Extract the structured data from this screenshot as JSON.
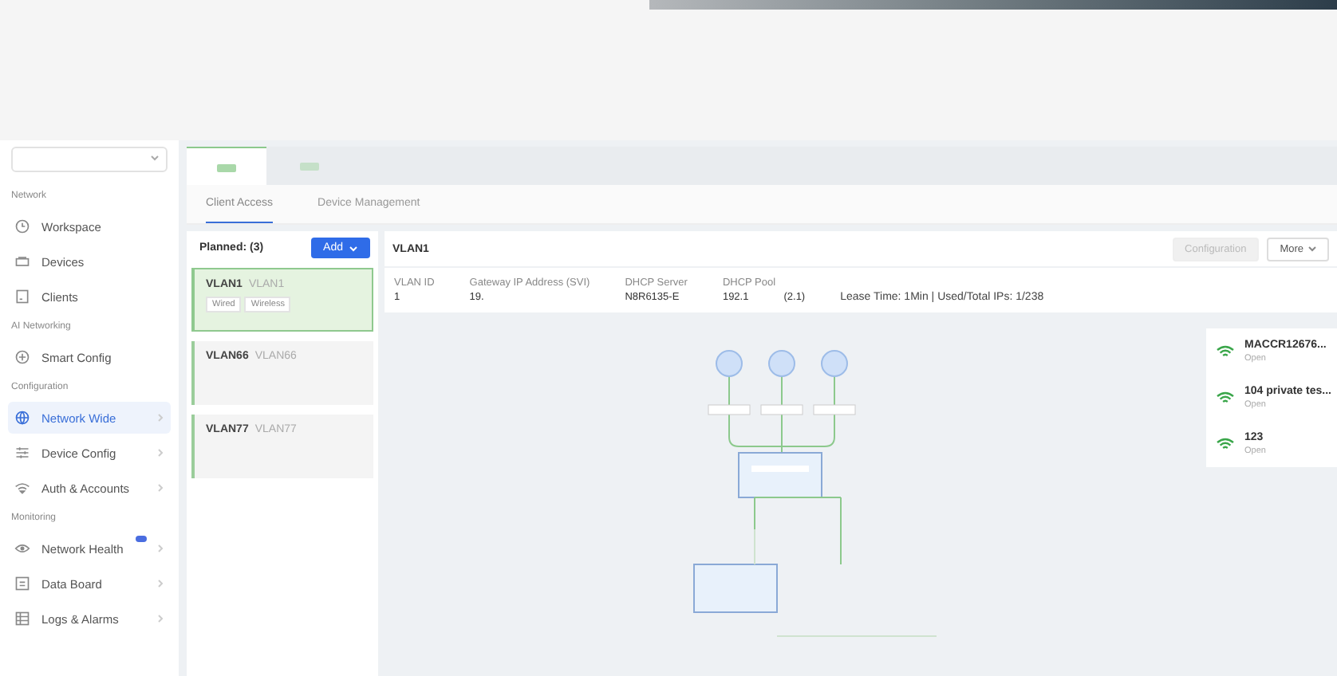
{
  "sidebar": {
    "sections": [
      {
        "label": "Network",
        "items": [
          {
            "label": "Workspace",
            "kind": "link",
            "selected": false
          },
          {
            "label": "Devices",
            "kind": "link",
            "selected": false
          },
          {
            "label": "Clients",
            "kind": "link",
            "selected": false
          }
        ]
      },
      {
        "label": "AI Networking",
        "items": [
          {
            "label": "Smart Config",
            "kind": "link",
            "selected": false
          }
        ]
      },
      {
        "label": "Configuration",
        "items": [
          {
            "label": "Network Wide",
            "kind": "group",
            "selected": true
          },
          {
            "label": "Device Config",
            "kind": "group",
            "selected": false
          },
          {
            "label": "Auth & Accounts",
            "kind": "group",
            "selected": false
          }
        ]
      },
      {
        "label": "Monitoring",
        "items": [
          {
            "label": "Network Health",
            "kind": "group",
            "selected": false,
            "badge": true
          },
          {
            "label": "Data Board",
            "kind": "group",
            "selected": false
          },
          {
            "label": "Logs & Alarms",
            "kind": "group",
            "selected": false
          }
        ]
      }
    ]
  },
  "device_tabs": [
    {
      "selected": true
    },
    {
      "selected": false
    }
  ],
  "tabs": [
    {
      "label": "Client Access",
      "selected": true
    },
    {
      "label": "Device Management",
      "selected": false
    }
  ],
  "vlan_list": {
    "title": "Planned:  (3)",
    "add_button": "Add",
    "items": [
      {
        "name": "VLAN1",
        "alias": "VLAN1",
        "selected": true,
        "tags": [
          "Wired",
          "Wireless"
        ]
      },
      {
        "name": "VLAN66",
        "alias": "VLAN66",
        "selected": false
      },
      {
        "name": "VLAN77",
        "alias": "VLAN77",
        "selected": false
      }
    ]
  },
  "detail": {
    "title": "VLAN1",
    "buttons": [
      {
        "label": "Configuration",
        "disabled": true
      },
      {
        "label": "More",
        "disabled": false
      }
    ],
    "fields": [
      {
        "label": "VLAN ID",
        "value": "1"
      },
      {
        "label": "Gateway IP Address (SVI)",
        "value": "19."
      },
      {
        "label": "DHCP Server",
        "value": "N8R6135-E"
      },
      {
        "label": "DHCP Pool",
        "value": "192.1",
        "extra": "(2.1)"
      }
    ],
    "lease": "Lease Time:  1Min  |  Used/Total IPs:  1/238",
    "ssids": [
      {
        "name": "MACCR12676...",
        "security": "Open"
      },
      {
        "name": "104 private tes...",
        "security": "Open"
      },
      {
        "name": "123",
        "security": "Open"
      }
    ]
  }
}
